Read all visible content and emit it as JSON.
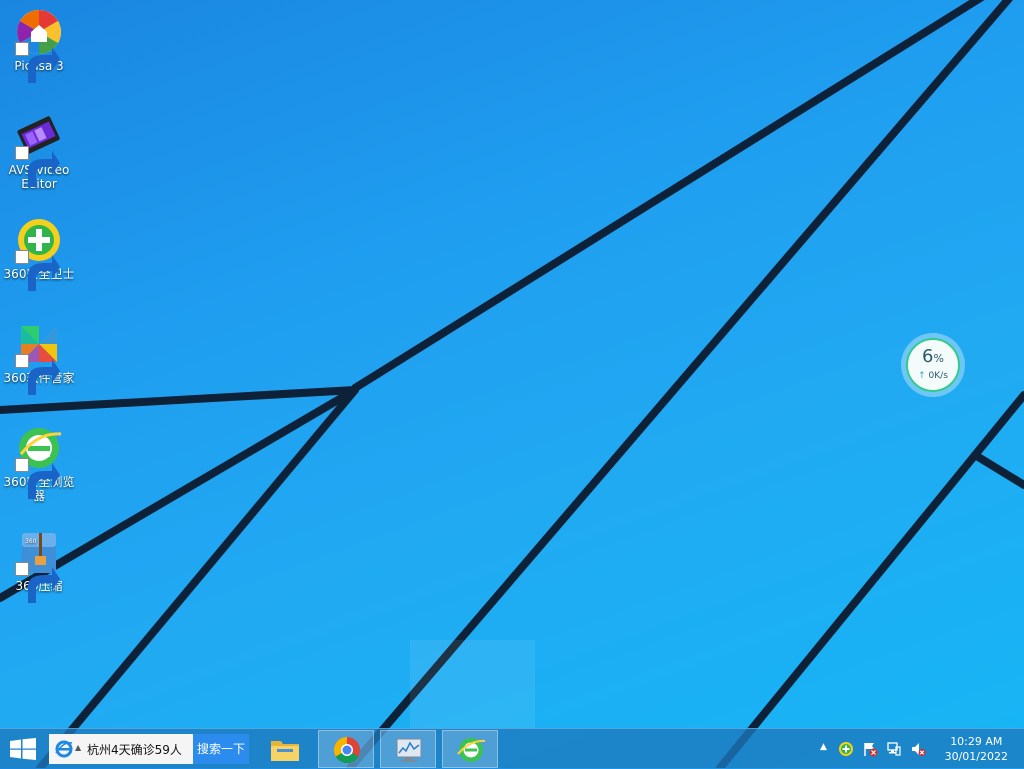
{
  "desktop": {
    "icons": [
      {
        "label": "Picasa 3",
        "icon": "picasa-icon"
      },
      {
        "label": "AVS Video Editor",
        "icon": "avs-video-editor-icon"
      },
      {
        "label": "360安全卫士",
        "icon": "360-safe-icon"
      },
      {
        "label": "360软件管家",
        "icon": "360-software-manager-icon"
      },
      {
        "label": "360安全浏览器",
        "icon": "360-browser-icon"
      },
      {
        "label": "360压缩",
        "icon": "360-zip-icon"
      }
    ]
  },
  "speed_widget": {
    "percent": "6",
    "percent_unit": "%",
    "rate": "0K/s"
  },
  "taskbar": {
    "search": {
      "value": "杭州4天确诊59人",
      "button_label": "搜索一下"
    },
    "pinned": [
      {
        "name": "file-explorer-icon",
        "active": false
      },
      {
        "name": "chrome-icon",
        "active": true
      },
      {
        "name": "system-monitor-icon",
        "active": true
      },
      {
        "name": "360-browser-icon",
        "active": true
      }
    ],
    "tray": {
      "icons": [
        "show-hidden-icons-chevron",
        "360-safe-tray-icon",
        "action-center-flag-icon",
        "network-icon",
        "volume-muted-icon"
      ]
    },
    "clock": {
      "time": "10:29 AM",
      "date": "30/01/2022"
    }
  },
  "colors": {
    "wallpaper_blue": "#1f9ef0",
    "taskbar": "#1e78be",
    "search_button": "#2b8cee",
    "widget_ring": "#36c98e"
  }
}
